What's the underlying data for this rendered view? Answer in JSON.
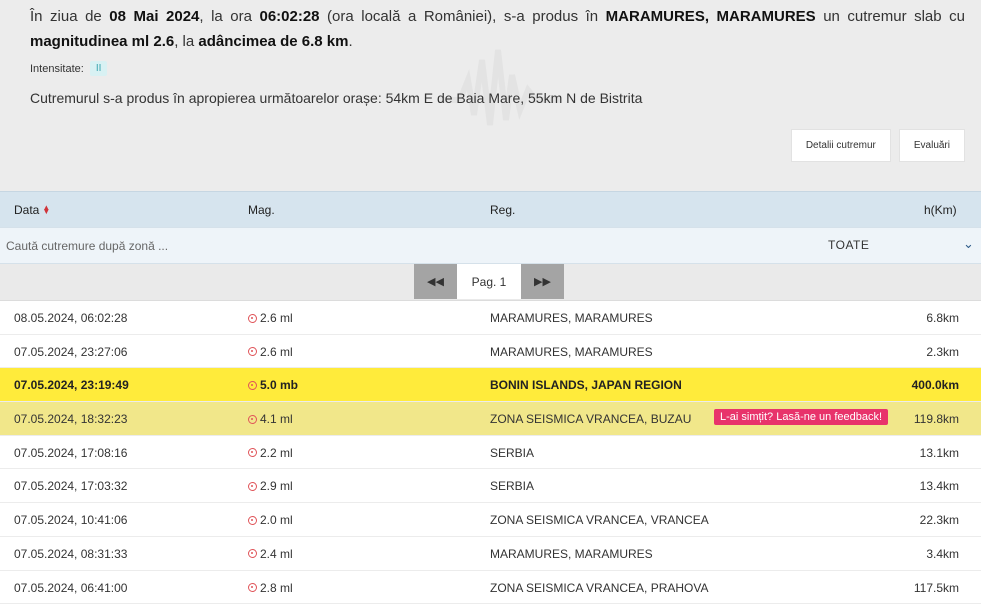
{
  "summary": {
    "p1": "În ziua de ",
    "date": "08 Mai 2024",
    "p2": ", la ora ",
    "time": "06:02:28",
    "p3": " (ora locală a României), s-a produs în ",
    "zone": "MARAMURES, MARAMURES",
    "p4": " un cutremur slab cu ",
    "mag_label": "magnitudinea ml 2.6",
    "p5": ", la ",
    "depth_label": "adâncimea de 6.8 km",
    "p6": "."
  },
  "intensity": {
    "label": "Intensitate:",
    "value": "II"
  },
  "nearby": "Cutremurul s-a produs în apropierea următoarelor orașe: 54km E de Baia Mare, 55km N de Bistrita",
  "buttons": {
    "details": "Detalii cutremur",
    "ratings": "Evaluări"
  },
  "table": {
    "headers": {
      "date": "Data",
      "mag": "Mag.",
      "region": "Reg.",
      "depth": "h(Km)"
    },
    "search_placeholder": "Caută cutremure după zonă ...",
    "filter": "TOATE",
    "pager": {
      "prev": "◀◀",
      "page": "Pag. 1",
      "next": "▶▶"
    },
    "feedback": "L-ai simțit? Lasă-ne un feedback!",
    "rows": [
      {
        "date": "08.05.2024, 06:02:28",
        "mag": "2.6 ml",
        "region": "MARAMURES, MARAMURES",
        "depth": "6.8km"
      },
      {
        "date": "07.05.2024, 23:27:06",
        "mag": "2.6 ml",
        "region": "MARAMURES, MARAMURES",
        "depth": "2.3km"
      },
      {
        "date": "07.05.2024, 23:19:49",
        "mag": "5.0 mb",
        "region": "BONIN ISLANDS, JAPAN REGION",
        "depth": "400.0km"
      },
      {
        "date": "07.05.2024, 18:32:23",
        "mag": "4.1 ml",
        "region": "ZONA SEISMICA VRANCEA, BUZAU",
        "depth": "119.8km"
      },
      {
        "date": "07.05.2024, 17:08:16",
        "mag": "2.2 ml",
        "region": "SERBIA",
        "depth": "13.1km"
      },
      {
        "date": "07.05.2024, 17:03:32",
        "mag": "2.9 ml",
        "region": "SERBIA",
        "depth": "13.4km"
      },
      {
        "date": "07.05.2024, 10:41:06",
        "mag": "2.0 ml",
        "region": "ZONA SEISMICA VRANCEA, VRANCEA",
        "depth": "22.3km"
      },
      {
        "date": "07.05.2024, 08:31:33",
        "mag": "2.4 ml",
        "region": "MARAMURES, MARAMURES",
        "depth": "3.4km"
      },
      {
        "date": "07.05.2024, 06:41:00",
        "mag": "2.8 ml",
        "region": "ZONA SEISMICA VRANCEA, PRAHOVA",
        "depth": "117.5km"
      }
    ]
  }
}
